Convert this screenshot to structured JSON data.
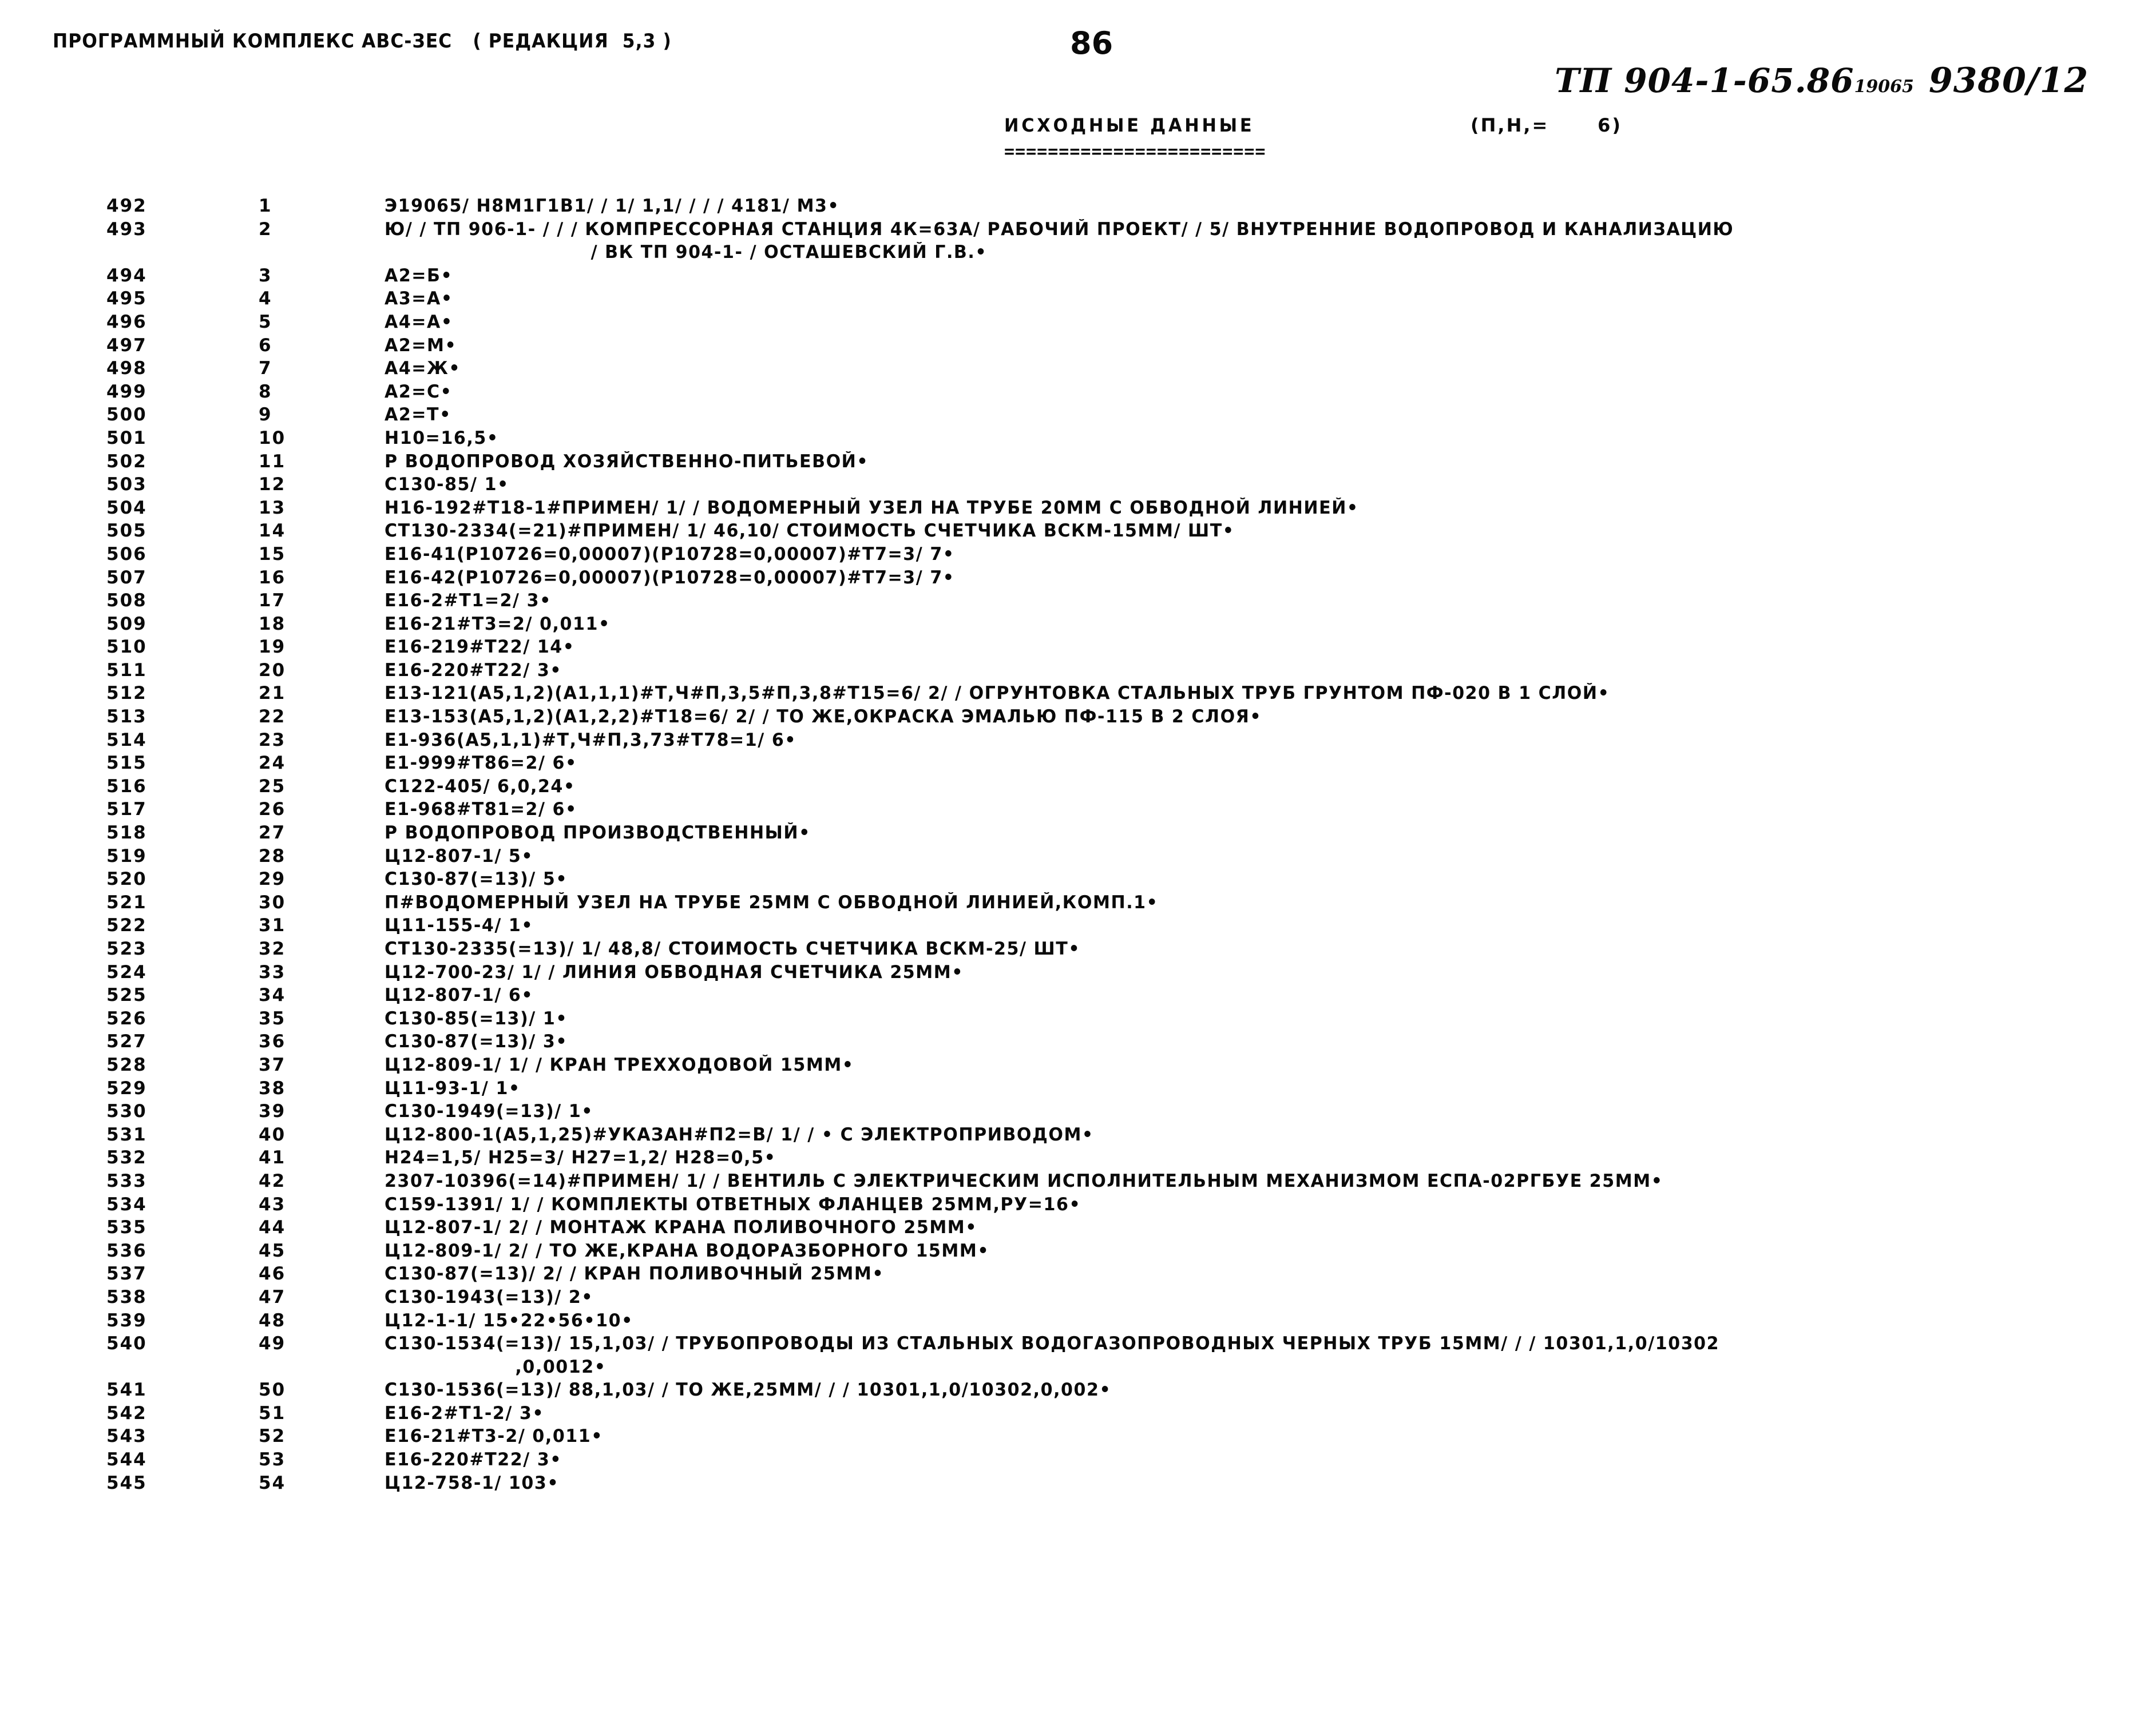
{
  "header": {
    "left": "ПРОГРАММНЫЙ КОМПЛЕКС АВС-ЗЕС   ( РЕДАКЦИЯ  5,3 )",
    "page_number": "86",
    "stamp_code": "ТП 904-1-65.86",
    "stamp_small": "19065",
    "stamp_lot": "9380/12"
  },
  "title": {
    "main": "ИСХОДНЫЕ ДАННЫЕ",
    "note": "(П,Н,=      6)",
    "rule": "========================"
  },
  "columns": {
    "seq_header": "",
    "num_header": "",
    "text_header": ""
  },
  "rows": [
    {
      "seq": "492",
      "num": "1",
      "text": "Э19065/ Н8М1Г1В1/ / 1/ 1,1/ / / / 4181/ М3•"
    },
    {
      "seq": "493",
      "num": "2",
      "text": "Ю/ / ТП 906-1- / / / КОМПРЕССОРНАЯ СТАНЦИЯ 4К=63А/ РАБОЧИЙ ПРОЕКТ/ / 5/ ВНУТРЕННИЕ ВОДОПРОВОД И КАНАЛИЗАЦИЮ"
    },
    {
      "seq": "",
      "num": "",
      "text": "                              / ВК ТП 904-1- / ОСТАШЕВСКИЙ Г.В.•",
      "cont": true
    },
    {
      "seq": "494",
      "num": "3",
      "text": "А2=Б•"
    },
    {
      "seq": "495",
      "num": "4",
      "text": "А3=А•"
    },
    {
      "seq": "496",
      "num": "5",
      "text": "А4=А•"
    },
    {
      "seq": "497",
      "num": "6",
      "text": "А2=М•"
    },
    {
      "seq": "498",
      "num": "7",
      "text": "А4=Ж•"
    },
    {
      "seq": "499",
      "num": "8",
      "text": "А2=С•"
    },
    {
      "seq": "500",
      "num": "9",
      "text": "А2=Т•"
    },
    {
      "seq": "501",
      "num": "10",
      "text": "Н10=16,5•"
    },
    {
      "seq": "502",
      "num": "11",
      "text": "Р ВОДОПРОВОД ХОЗЯЙСТВЕННО-ПИТЬЕВОЙ•"
    },
    {
      "seq": "503",
      "num": "12",
      "text": "С130-85/ 1•"
    },
    {
      "seq": "504",
      "num": "13",
      "text": "Н16-192#Т18-1#ПРИМЕН/ 1/ / ВОДОМЕРНЫЙ УЗЕЛ НА ТРУБЕ 20ММ С ОБВОДНОЙ ЛИНИЕЙ•"
    },
    {
      "seq": "505",
      "num": "14",
      "text": "СТ130-2334(=21)#ПРИМЕН/ 1/ 46,10/ СТОИМОСТЬ СЧЕТЧИКА ВСКМ-15ММ/ ШТ•"
    },
    {
      "seq": "506",
      "num": "15",
      "text": "Е16-41(Р10726=0,00007)(Р10728=0,00007)#Т7=3/ 7•"
    },
    {
      "seq": "507",
      "num": "16",
      "text": "Е16-42(Р10726=0,00007)(Р10728=0,00007)#Т7=3/ 7•"
    },
    {
      "seq": "508",
      "num": "17",
      "text": "Е16-2#Т1=2/ 3•"
    },
    {
      "seq": "509",
      "num": "18",
      "text": "Е16-21#Т3=2/ 0,011•"
    },
    {
      "seq": "510",
      "num": "19",
      "text": "Е16-219#Т22/ 14•"
    },
    {
      "seq": "511",
      "num": "20",
      "text": "Е16-220#Т22/ 3•"
    },
    {
      "seq": "512",
      "num": "21",
      "text": "Е13-121(А5,1,2)(А1,1,1)#Т,Ч#П,3,5#П,3,8#Т15=6/ 2/ / ОГРУНТОВКА СТАЛЬНЫХ ТРУБ ГРУНТОМ ПФ-020 В 1 СЛОЙ•"
    },
    {
      "seq": "513",
      "num": "22",
      "text": "Е13-153(А5,1,2)(А1,2,2)#Т18=6/ 2/ / ТО ЖЕ,ОКРАСКА ЭМАЛЬЮ ПФ-115 В 2 СЛОЯ•"
    },
    {
      "seq": "514",
      "num": "23",
      "text": "Е1-936(А5,1,1)#Т,Ч#П,3,73#Т78=1/ 6•"
    },
    {
      "seq": "515",
      "num": "24",
      "text": "Е1-999#Т86=2/ 6•"
    },
    {
      "seq": "516",
      "num": "25",
      "text": "С122-405/ 6,0,24•"
    },
    {
      "seq": "517",
      "num": "26",
      "text": "Е1-968#Т81=2/ 6•"
    },
    {
      "seq": "518",
      "num": "27",
      "text": "Р ВОДОПРОВОД ПРОИЗВОДСТВЕННЫЙ•"
    },
    {
      "seq": "519",
      "num": "28",
      "text": "Ц12-807-1/ 5•"
    },
    {
      "seq": "520",
      "num": "29",
      "text": "С130-87(=13)/ 5•"
    },
    {
      "seq": "521",
      "num": "30",
      "text": "П#ВОДОМЕРНЫЙ УЗЕЛ НА ТРУБЕ 25ММ С ОБВОДНОЙ ЛИНИЕЙ,КОМП.1•"
    },
    {
      "seq": "522",
      "num": "31",
      "text": "Ц11-155-4/ 1•"
    },
    {
      "seq": "523",
      "num": "32",
      "text": "СТ130-2335(=13)/ 1/ 48,8/ СТОИМОСТЬ СЧЕТЧИКА ВСКМ-25/ ШТ•"
    },
    {
      "seq": "524",
      "num": "33",
      "text": "Ц12-700-23/ 1/ / ЛИНИЯ ОБВОДНАЯ СЧЕТЧИКА 25ММ•"
    },
    {
      "seq": "525",
      "num": "34",
      "text": "Ц12-807-1/ 6•"
    },
    {
      "seq": "526",
      "num": "35",
      "text": "С130-85(=13)/ 1•"
    },
    {
      "seq": "527",
      "num": "36",
      "text": "С130-87(=13)/ 3•"
    },
    {
      "seq": "528",
      "num": "37",
      "text": "Ц12-809-1/ 1/ / КРАН ТРЕХХОДОВОЙ 15ММ•"
    },
    {
      "seq": "529",
      "num": "38",
      "text": "Ц11-93-1/ 1•"
    },
    {
      "seq": "530",
      "num": "39",
      "text": "С130-1949(=13)/ 1•"
    },
    {
      "seq": "531",
      "num": "40",
      "text": "Ц12-800-1(А5,1,25)#УКАЗАН#П2=В/ 1/ / • С ЭЛЕКТРОПРИВОДОМ•"
    },
    {
      "seq": "532",
      "num": "41",
      "text": "Н24=1,5/ Н25=3/ Н27=1,2/ Н28=0,5•"
    },
    {
      "seq": "533",
      "num": "42",
      "text": "2307-10396(=14)#ПРИМЕН/ 1/ / ВЕНТИЛЬ С ЭЛЕКТРИЧЕСКИМ ИСПОЛНИТЕЛЬНЫМ МЕХАНИЗМОМ ЕСПА-02РГБУЕ 25ММ•"
    },
    {
      "seq": "534",
      "num": "43",
      "text": "С159-1391/ 1/ / КОМПЛЕКТЫ ОТВЕТНЫХ ФЛАНЦЕВ 25ММ,РУ=16•"
    },
    {
      "seq": "535",
      "num": "44",
      "text": "Ц12-807-1/ 2/ / МОНТАЖ КРАНА ПОЛИВОЧНОГО 25ММ•"
    },
    {
      "seq": "536",
      "num": "45",
      "text": "Ц12-809-1/ 2/ / ТО ЖЕ,КРАНА ВОДОРАЗБОРНОГО 15ММ•"
    },
    {
      "seq": "537",
      "num": "46",
      "text": "С130-87(=13)/ 2/ / КРАН ПОЛИВОЧНЫЙ 25ММ•"
    },
    {
      "seq": "538",
      "num": "47",
      "text": "С130-1943(=13)/ 2•"
    },
    {
      "seq": "539",
      "num": "48",
      "text": "Ц12-1-1/ 15•22•56•10•"
    },
    {
      "seq": "540",
      "num": "49",
      "text": "С130-1534(=13)/ 15,1,03/ / ТРУБОПРОВОДЫ ИЗ СТАЛЬНЫХ ВОДОГАЗОПРОВОДНЫХ ЧЕРНЫХ ТРУБ 15ММ/ / / 10301,1,0/10302"
    },
    {
      "seq": "",
      "num": "",
      "text": "                   ,0,0012•",
      "cont": true
    },
    {
      "seq": "541",
      "num": "50",
      "text": "С130-1536(=13)/ 88,1,03/ / ТО ЖЕ,25ММ/ / / 10301,1,0/10302,0,002•"
    },
    {
      "seq": "542",
      "num": "51",
      "text": "Е16-2#Т1-2/ 3•"
    },
    {
      "seq": "543",
      "num": "52",
      "text": "Е16-21#Т3-2/ 0,011•"
    },
    {
      "seq": "544",
      "num": "53",
      "text": "Е16-220#Т22/ 3•"
    },
    {
      "seq": "545",
      "num": "54",
      "text": "Ц12-758-1/ 103•"
    }
  ]
}
